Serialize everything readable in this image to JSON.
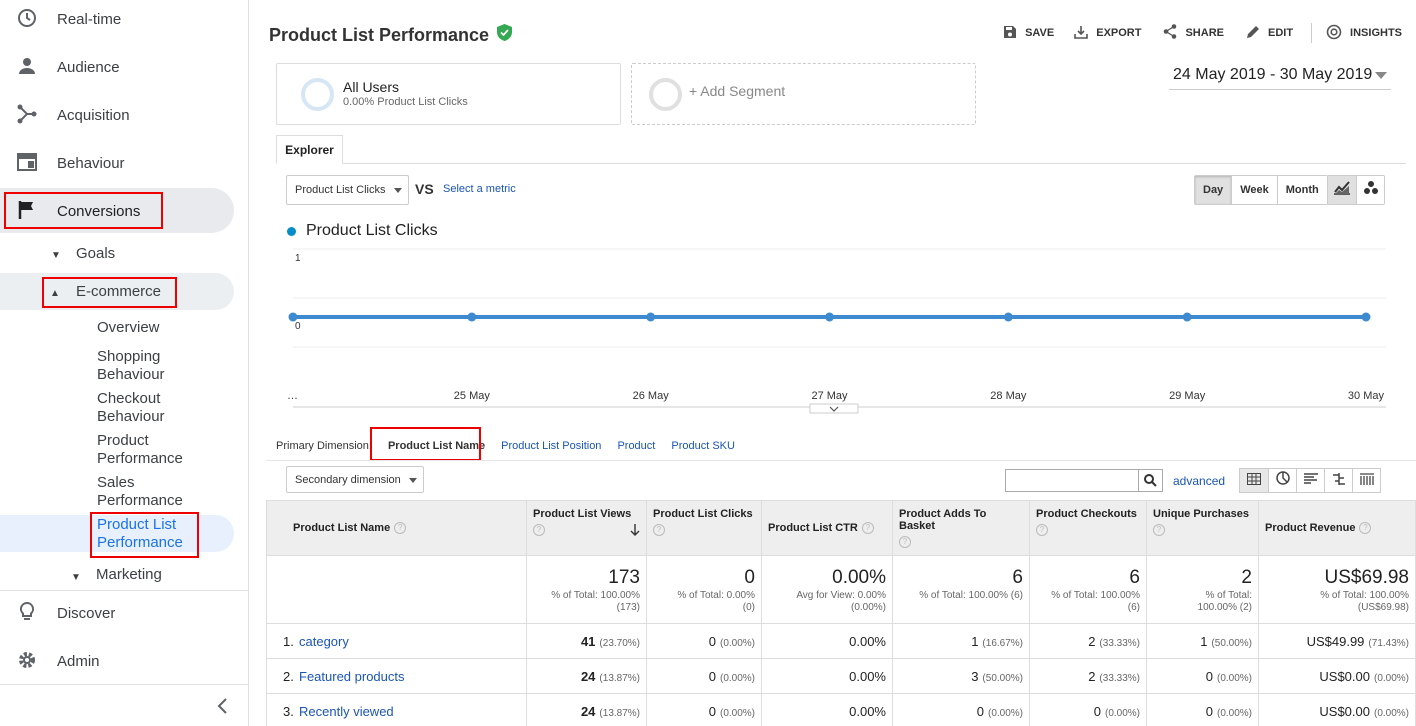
{
  "sidebar": {
    "top_items": [
      {
        "label": "Real-time",
        "icon": "clock-icon"
      },
      {
        "label": "Audience",
        "icon": "person-icon"
      },
      {
        "label": "Acquisition",
        "icon": "acquisition-icon"
      },
      {
        "label": "Behaviour",
        "icon": "behaviour-icon"
      },
      {
        "label": "Conversions",
        "icon": "flag-icon"
      }
    ],
    "goals": "Goals",
    "ecommerce": "E-commerce",
    "ecom_items": [
      {
        "line1": "Overview",
        "line2": ""
      },
      {
        "line1": "Shopping",
        "line2": "Behaviour"
      },
      {
        "line1": "Checkout",
        "line2": "Behaviour"
      },
      {
        "line1": "Product",
        "line2": "Performance"
      },
      {
        "line1": "Sales",
        "line2": "Performance"
      },
      {
        "line1": "Product List",
        "line2": "Performance"
      }
    ],
    "marketing": "Marketing",
    "bottom_items": [
      {
        "label": "Discover",
        "icon": "lightbulb-icon"
      },
      {
        "label": "Admin",
        "icon": "gear-icon"
      }
    ]
  },
  "header": {
    "title": "Product List Performance",
    "actions": {
      "save": "SAVE",
      "export": "EXPORT",
      "share": "SHARE",
      "edit": "EDIT",
      "insights": "INSIGHTS"
    }
  },
  "segments": {
    "all_users_title": "All Users",
    "all_users_sub": "0.00% Product List Clicks",
    "add_segment": "+ Add Segment"
  },
  "date_range": "24 May 2019 - 30 May 2019",
  "explorer": {
    "tab": "Explorer",
    "metric": "Product List Clicks",
    "vs": "VS",
    "select_metric": "Select a metric",
    "periods": [
      "Day",
      "Week",
      "Month"
    ],
    "active_period": "Day"
  },
  "chart_data": {
    "type": "line",
    "x": [
      "…",
      "25 May",
      "26 May",
      "27 May",
      "28 May",
      "29 May",
      "30 May"
    ],
    "series": [
      {
        "name": "Product List Clicks",
        "values": [
          0,
          0,
          0,
          0,
          0,
          0,
          0
        ]
      }
    ],
    "y_ticks": [
      "1",
      "0"
    ],
    "ylim": [
      0,
      1
    ],
    "color": "#3d8ad1"
  },
  "dimensions": {
    "label": "Primary Dimension:",
    "selected": "Product List Name",
    "others": [
      "Product List Position",
      "Product",
      "Product SKU"
    ],
    "secondary": "Secondary dimension",
    "advanced": "advanced"
  },
  "table": {
    "headers": [
      "Product List Name",
      "Product List Views",
      "Product List Clicks",
      "Product List CTR",
      "Product Adds To Basket",
      "Product Checkouts",
      "Unique Purchases",
      "Product Revenue"
    ],
    "totals": [
      {
        "value": "173",
        "sub1": "% of Total: 100.00%",
        "sub2": "(173)"
      },
      {
        "value": "0",
        "sub1": "% of Total: 0.00%",
        "sub2": "(0)"
      },
      {
        "value": "0.00%",
        "sub1": "Avg for View: 0.00%",
        "sub2": "(0.00%)"
      },
      {
        "value": "6",
        "sub1": "% of Total: 100.00% (6)",
        "sub2": ""
      },
      {
        "value": "6",
        "sub1": "% of Total: 100.00%",
        "sub2": "(6)"
      },
      {
        "value": "2",
        "sub1": "% of Total:",
        "sub2": "100.00% (2)"
      },
      {
        "value": "US$69.98",
        "sub1": "% of Total: 100.00%",
        "sub2": "(US$69.98)"
      }
    ],
    "rows": [
      {
        "idx": "1.",
        "name": "category",
        "views": "41",
        "views_pct": "(23.70%)",
        "clicks": "0",
        "clicks_pct": "(0.00%)",
        "ctr": "0.00%",
        "adds": "1",
        "adds_pct": "(16.67%)",
        "checkouts": "2",
        "checkouts_pct": "(33.33%)",
        "purchases": "1",
        "purchases_pct": "(50.00%)",
        "revenue": "US$49.99",
        "revenue_pct": "(71.43%)"
      },
      {
        "idx": "2.",
        "name": "Featured products",
        "views": "24",
        "views_pct": "(13.87%)",
        "clicks": "0",
        "clicks_pct": "(0.00%)",
        "ctr": "0.00%",
        "adds": "3",
        "adds_pct": "(50.00%)",
        "checkouts": "2",
        "checkouts_pct": "(33.33%)",
        "purchases": "0",
        "purchases_pct": "(0.00%)",
        "revenue": "US$0.00",
        "revenue_pct": "(0.00%)"
      },
      {
        "idx": "3.",
        "name": "Recently viewed",
        "views": "24",
        "views_pct": "(13.87%)",
        "clicks": "0",
        "clicks_pct": "(0.00%)",
        "ctr": "0.00%",
        "adds": "0",
        "adds_pct": "(0.00%)",
        "checkouts": "0",
        "checkouts_pct": "(0.00%)",
        "purchases": "0",
        "purchases_pct": "(0.00%)",
        "revenue": "US$0.00",
        "revenue_pct": "(0.00%)"
      }
    ]
  }
}
